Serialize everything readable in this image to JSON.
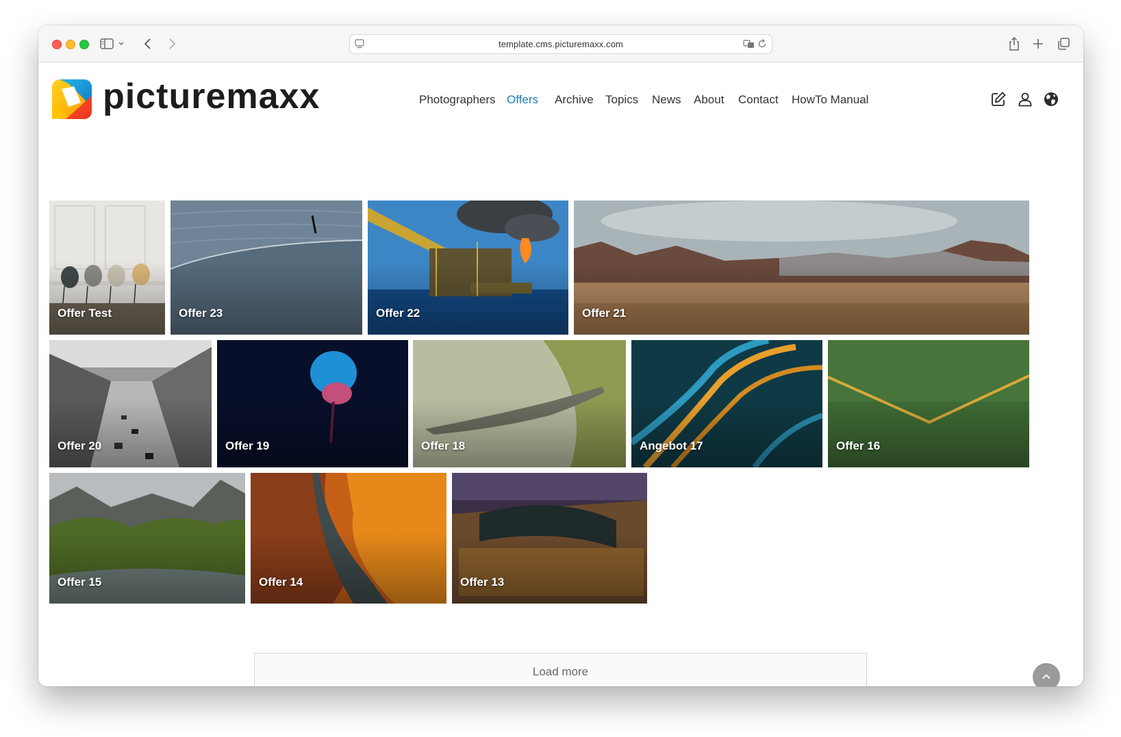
{
  "browser": {
    "url": "template.cms.picturemaxx.com"
  },
  "site": {
    "logo_text": "picturemaxx",
    "nav": [
      {
        "label": "Photographers",
        "active": false
      },
      {
        "label": "Offers",
        "active": true
      },
      {
        "label": "Archive",
        "active": false
      },
      {
        "label": "Topics",
        "active": false
      },
      {
        "label": "News",
        "active": false
      },
      {
        "label": "About",
        "active": false
      },
      {
        "label": "Contact",
        "active": false
      },
      {
        "label": "HowTo Manual",
        "active": false
      }
    ],
    "accent_color": "#1a7fbc",
    "header_icons": [
      "edit-icon",
      "user-icon",
      "globe-icon"
    ]
  },
  "gallery": {
    "tiles": [
      {
        "label": "Offer Test"
      },
      {
        "label": "Offer 23"
      },
      {
        "label": "Offer 22"
      },
      {
        "label": "Offer 21"
      },
      {
        "label": "Offer 20"
      },
      {
        "label": "Offer 19"
      },
      {
        "label": "Offer 18"
      },
      {
        "label": "Angebot 17"
      },
      {
        "label": "Offer 16"
      },
      {
        "label": "Offer 15"
      },
      {
        "label": "Offer 14"
      },
      {
        "label": "Offer 13"
      }
    ],
    "load_more_label": "Load more"
  }
}
